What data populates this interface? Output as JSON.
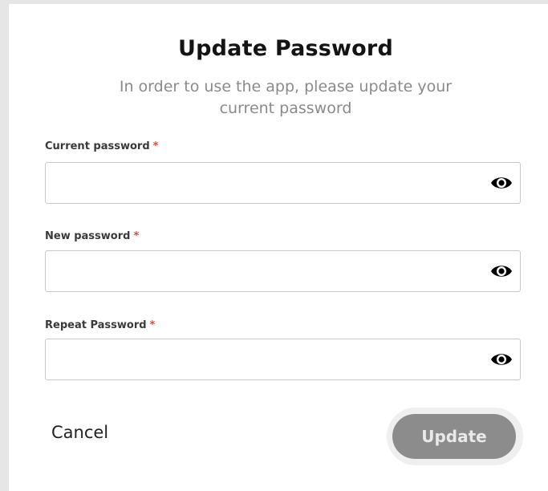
{
  "dialog": {
    "title": "Update Password",
    "subtitle_line1": "In order to use the app, please update your",
    "subtitle_line2": "current password"
  },
  "fields": [
    {
      "label": "Current password",
      "required_mark": "*",
      "value": "",
      "placeholder": "",
      "icon": "eye-icon"
    },
    {
      "label": "New password",
      "required_mark": "*",
      "value": "",
      "placeholder": "",
      "icon": "eye-icon"
    },
    {
      "label": "Repeat Password",
      "required_mark": "*",
      "value": "",
      "placeholder": "",
      "icon": "eye-icon"
    }
  ],
  "actions": {
    "cancel_label": "Cancel",
    "update_label": "Update"
  },
  "colors": {
    "required": "#e0453f",
    "button_disabled": "#8c8c8c",
    "subtitle": "#8a8a8a"
  }
}
